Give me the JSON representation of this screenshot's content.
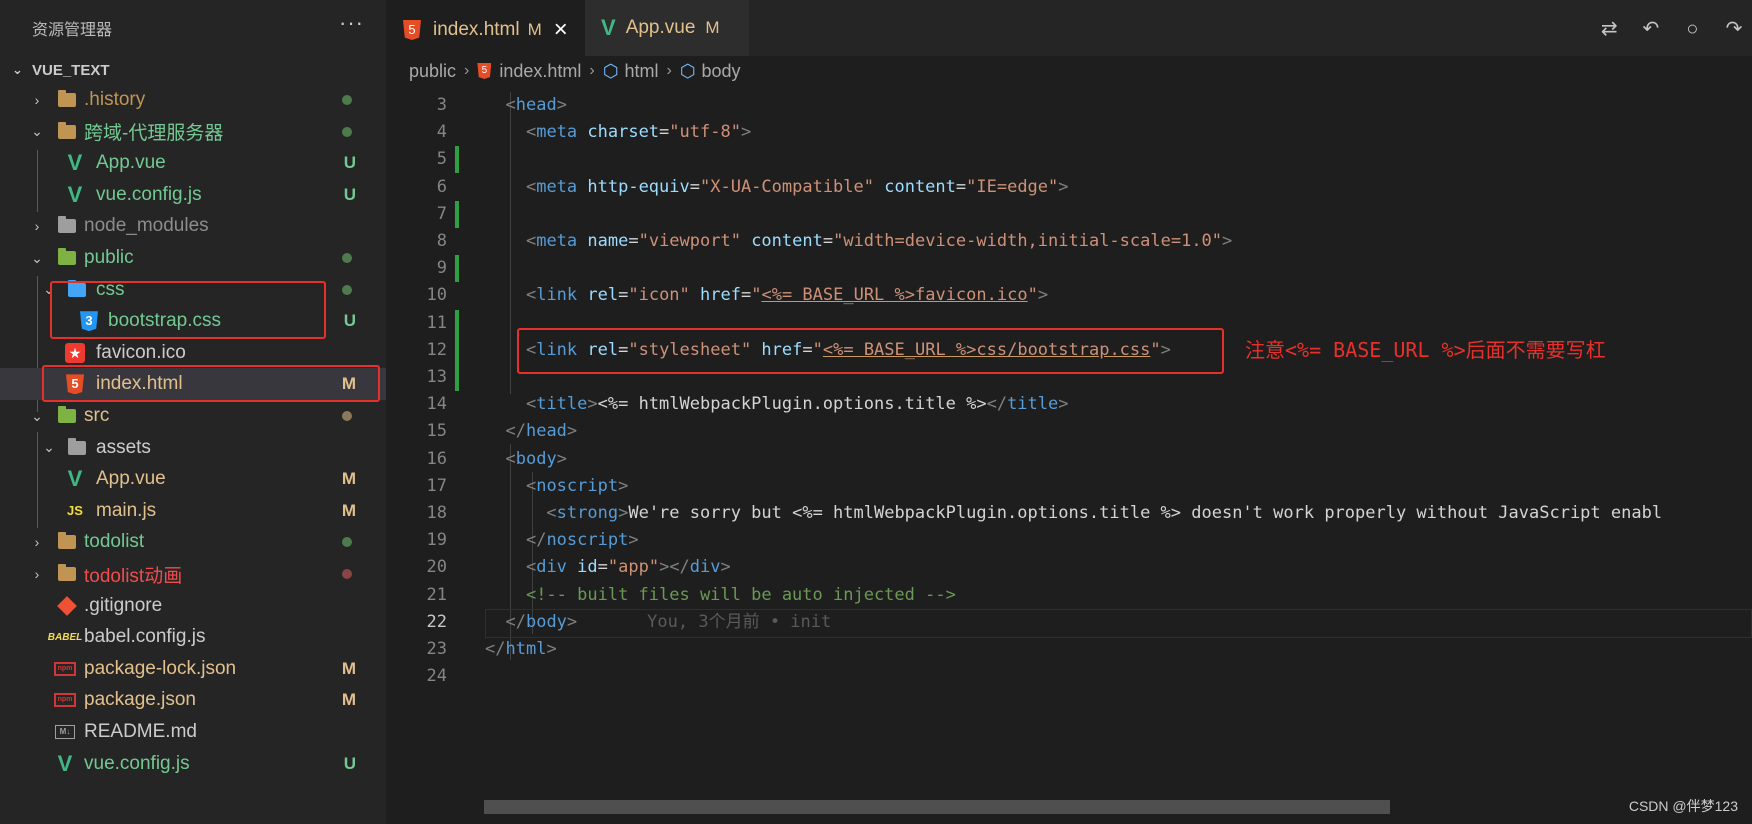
{
  "sidebar": {
    "title": "资源管理器",
    "more": "···",
    "root_label": "VUE_TEXT",
    "items": [
      {
        "label": ".history",
        "color": "#c09553",
        "badge": "",
        "dot": "#4e7a4e"
      },
      {
        "label": "跨域-代理服务器",
        "color": "#73c991",
        "badge": "",
        "dot": "#4e7a4e"
      },
      {
        "label": "App.vue",
        "color": "#73c991",
        "badge": "U",
        "dot": ""
      },
      {
        "label": "vue.config.js",
        "color": "#73c991",
        "badge": "U",
        "dot": ""
      },
      {
        "label": "node_modules",
        "color": "#8c8c8c",
        "badge": "",
        "dot": ""
      },
      {
        "label": "public",
        "color": "#73c991",
        "badge": "",
        "dot": "#4e7a4e"
      },
      {
        "label": "css",
        "color": "#73c991",
        "badge": "",
        "dot": "#4e7a4e"
      },
      {
        "label": "bootstrap.css",
        "color": "#73c991",
        "badge": "U",
        "dot": ""
      },
      {
        "label": "favicon.ico",
        "color": "#cccccc",
        "badge": "",
        "dot": ""
      },
      {
        "label": "index.html",
        "color": "#e2c08d",
        "badge": "M",
        "dot": ""
      },
      {
        "label": "src",
        "color": "#e2c08d",
        "badge": "",
        "dot": "#8a7a5a"
      },
      {
        "label": "assets",
        "color": "#cccccc",
        "badge": "",
        "dot": ""
      },
      {
        "label": "App.vue",
        "color": "#e2c08d",
        "badge": "M",
        "dot": ""
      },
      {
        "label": "main.js",
        "color": "#e2c08d",
        "badge": "M",
        "dot": ""
      },
      {
        "label": "todolist",
        "color": "#73c991",
        "badge": "",
        "dot": "#4e7a4e"
      },
      {
        "label": "todolist动画",
        "color": "#f14c4c",
        "badge": "",
        "dot": "#8a4444"
      },
      {
        "label": ".gitignore",
        "color": "#cccccc",
        "badge": "",
        "dot": ""
      },
      {
        "label": "babel.config.js",
        "color": "#cccccc",
        "badge": "",
        "dot": ""
      },
      {
        "label": "package-lock.json",
        "color": "#e2c08d",
        "badge": "M",
        "dot": ""
      },
      {
        "label": "package.json",
        "color": "#e2c08d",
        "badge": "M",
        "dot": ""
      },
      {
        "label": "README.md",
        "color": "#cccccc",
        "badge": "",
        "dot": ""
      },
      {
        "label": "vue.config.js",
        "color": "#73c991",
        "badge": "U",
        "dot": ""
      }
    ],
    "icon_texts": {
      "js": "JS",
      "babel": "BABEL",
      "npm": "npm",
      "md": "M↓",
      "star": "★",
      "html5": "5",
      "css3": "3",
      "vue": "V"
    }
  },
  "tabs": [
    {
      "label": "index.html",
      "status": "M",
      "close": "×"
    },
    {
      "label": "App.vue",
      "status": "M"
    }
  ],
  "tab_actions": [
    "⇄",
    "↶",
    "○",
    "↷"
  ],
  "breadcrumb": [
    "public",
    "index.html",
    "html",
    "body"
  ],
  "editor": {
    "current_line": 22,
    "lines": [
      {
        "n": "3",
        "seg": [
          [
            "  ",
            "t"
          ],
          [
            "<",
            "b"
          ],
          [
            "head",
            "g"
          ],
          [
            ">",
            "b"
          ]
        ]
      },
      {
        "n": "4",
        "seg": [
          [
            "    ",
            "t"
          ],
          [
            "<",
            "b"
          ],
          [
            "meta",
            "g"
          ],
          [
            " charset",
            "a"
          ],
          [
            "=",
            "t"
          ],
          [
            "\"utf-8\"",
            "s"
          ],
          [
            ">",
            "b"
          ]
        ]
      },
      {
        "n": "5",
        "seg": []
      },
      {
        "n": "6",
        "seg": [
          [
            "    ",
            "t"
          ],
          [
            "<",
            "b"
          ],
          [
            "meta",
            "g"
          ],
          [
            " http-equiv",
            "a"
          ],
          [
            "=",
            "t"
          ],
          [
            "\"X-UA-Compatible\"",
            "s"
          ],
          [
            " content",
            "a"
          ],
          [
            "=",
            "t"
          ],
          [
            "\"IE=edge\"",
            "s"
          ],
          [
            ">",
            "b"
          ]
        ]
      },
      {
        "n": "7",
        "seg": []
      },
      {
        "n": "8",
        "seg": [
          [
            "    ",
            "t"
          ],
          [
            "<",
            "b"
          ],
          [
            "meta",
            "g"
          ],
          [
            " name",
            "a"
          ],
          [
            "=",
            "t"
          ],
          [
            "\"viewport\"",
            "s"
          ],
          [
            " content",
            "a"
          ],
          [
            "=",
            "t"
          ],
          [
            "\"width=device-width,initial-scale=1.0\"",
            "s"
          ],
          [
            ">",
            "b"
          ]
        ]
      },
      {
        "n": "9",
        "seg": []
      },
      {
        "n": "10",
        "seg": [
          [
            "    ",
            "t"
          ],
          [
            "<",
            "b"
          ],
          [
            "link",
            "g"
          ],
          [
            " rel",
            "a"
          ],
          [
            "=",
            "t"
          ],
          [
            "\"icon\"",
            "s"
          ],
          [
            " href",
            "a"
          ],
          [
            "=",
            "t"
          ],
          [
            "\"",
            "s"
          ],
          [
            "<%= BASE_URL %>favicon.ico",
            "u"
          ],
          [
            "\"",
            "s"
          ],
          [
            ">",
            "b"
          ]
        ]
      },
      {
        "n": "11",
        "seg": []
      },
      {
        "n": "12",
        "seg": [
          [
            "    ",
            "t"
          ],
          [
            "<",
            "b"
          ],
          [
            "link",
            "g"
          ],
          [
            " rel",
            "a"
          ],
          [
            "=",
            "t"
          ],
          [
            "\"stylesheet\"",
            "s"
          ],
          [
            " href",
            "a"
          ],
          [
            "=",
            "t"
          ],
          [
            "\"",
            "s"
          ],
          [
            "<%= BASE_URL %>css/bootstrap.css",
            "u"
          ],
          [
            "\"",
            "s"
          ],
          [
            ">",
            "b"
          ]
        ]
      },
      {
        "n": "13",
        "seg": []
      },
      {
        "n": "14",
        "seg": [
          [
            "    ",
            "t"
          ],
          [
            "<",
            "b"
          ],
          [
            "title",
            "g"
          ],
          [
            ">",
            "b"
          ],
          [
            "<%= htmlWebpackPlugin.options.title %>",
            "x"
          ],
          [
            "</",
            "b"
          ],
          [
            "title",
            "g"
          ],
          [
            ">",
            "b"
          ]
        ]
      },
      {
        "n": "15",
        "seg": [
          [
            "  ",
            "t"
          ],
          [
            "</",
            "b"
          ],
          [
            "head",
            "g"
          ],
          [
            ">",
            "b"
          ]
        ]
      },
      {
        "n": "16",
        "seg": [
          [
            "  ",
            "t"
          ],
          [
            "<",
            "b"
          ],
          [
            "body",
            "g"
          ],
          [
            ">",
            "b"
          ]
        ]
      },
      {
        "n": "17",
        "seg": [
          [
            "    ",
            "t"
          ],
          [
            "<",
            "b"
          ],
          [
            "noscript",
            "g"
          ],
          [
            ">",
            "b"
          ]
        ]
      },
      {
        "n": "18",
        "seg": [
          [
            "      ",
            "t"
          ],
          [
            "<",
            "b"
          ],
          [
            "strong",
            "g"
          ],
          [
            ">",
            "b"
          ],
          [
            "We're sorry but <%= htmlWebpackPlugin.options.title %> doesn't work properly without JavaScript enabl",
            "x"
          ]
        ]
      },
      {
        "n": "19",
        "seg": [
          [
            "    ",
            "t"
          ],
          [
            "</",
            "b"
          ],
          [
            "noscript",
            "g"
          ],
          [
            ">",
            "b"
          ]
        ]
      },
      {
        "n": "20",
        "seg": [
          [
            "    ",
            "t"
          ],
          [
            "<",
            "b"
          ],
          [
            "div",
            "g"
          ],
          [
            " id",
            "a"
          ],
          [
            "=",
            "t"
          ],
          [
            "\"app\"",
            "s"
          ],
          [
            "></",
            "b"
          ],
          [
            "div",
            "g"
          ],
          [
            ">",
            "b"
          ]
        ]
      },
      {
        "n": "21",
        "seg": [
          [
            "    ",
            "t"
          ],
          [
            "<!-- built files will be auto injected -->",
            "c"
          ]
        ]
      },
      {
        "n": "22",
        "seg": [
          [
            "  ",
            "t"
          ],
          [
            "</",
            "b"
          ],
          [
            "body",
            "g"
          ],
          [
            ">",
            "b"
          ]
        ],
        "blame": "You, 3个月前 • init"
      },
      {
        "n": "23",
        "seg": [
          [
            "</",
            "b"
          ],
          [
            "html",
            "g"
          ],
          [
            ">",
            "b"
          ]
        ]
      },
      {
        "n": "24",
        "seg": []
      }
    ],
    "modified_lines": [
      "5",
      "7",
      "9",
      "11",
      "12",
      "13"
    ]
  },
  "annotation": "注意<%= BASE_URL %>后面不需要写杠",
  "watermark": "CSDN @伴梦123"
}
